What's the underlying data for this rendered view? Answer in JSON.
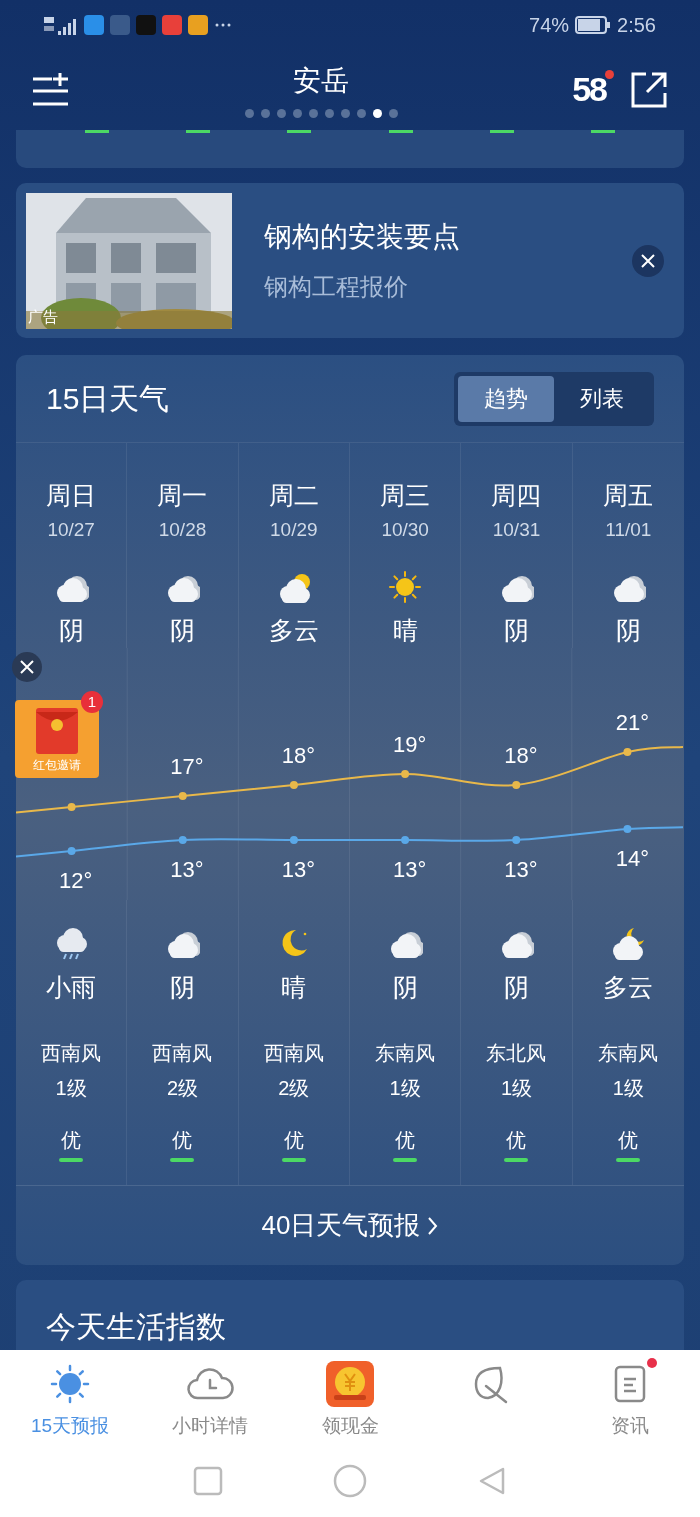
{
  "status_bar": {
    "battery_text": "74%",
    "time": "2:56",
    "app_icons": [
      {
        "color": "#2a8fe8"
      },
      {
        "color": "#3a5a8a"
      },
      {
        "color": "#111111"
      },
      {
        "color": "#e8403a"
      },
      {
        "color": "#e8a020"
      }
    ]
  },
  "header": {
    "city": "安岳",
    "logo_text": "58",
    "page_dots": [
      {
        "selected": false
      },
      {
        "selected": false
      },
      {
        "selected": false
      },
      {
        "selected": false
      },
      {
        "selected": false
      },
      {
        "selected": false
      },
      {
        "selected": false
      },
      {
        "selected": false
      },
      {
        "selected": true
      },
      {
        "selected": false
      }
    ]
  },
  "ad": {
    "tag": "广告",
    "title": "钢构的安装要点",
    "subtitle": "钢构工程报价"
  },
  "forecast": {
    "title": "15日天气",
    "tabs": [
      {
        "label": "趋势",
        "selected": true
      },
      {
        "label": "列表",
        "selected": false
      }
    ],
    "days": [
      {
        "weekday": "周日",
        "date": "10/27",
        "day": {
          "kind": "cloudy",
          "condition": "阴"
        },
        "low": "12°",
        "night": {
          "kind": "light-rain",
          "condition": "小雨"
        },
        "wind_direction": "西南风",
        "wind_level": "1级",
        "aqi": "优"
      },
      {
        "weekday": "周一",
        "date": "10/28",
        "day": {
          "kind": "cloudy",
          "condition": "阴"
        },
        "high": "17°",
        "low": "13°",
        "night": {
          "kind": "cloudy",
          "condition": "阴"
        },
        "wind_direction": "西南风",
        "wind_level": "2级",
        "aqi": "优"
      },
      {
        "weekday": "周二",
        "date": "10/29",
        "day": {
          "kind": "partly-cloudy-day",
          "condition": "多云"
        },
        "high": "18°",
        "low": "13°",
        "night": {
          "kind": "clear-night",
          "condition": "晴"
        },
        "wind_direction": "西南风",
        "wind_level": "2级",
        "aqi": "优"
      },
      {
        "weekday": "周三",
        "date": "10/30",
        "day": {
          "kind": "sunny",
          "condition": "晴"
        },
        "high": "19°",
        "low": "13°",
        "night": {
          "kind": "cloudy",
          "condition": "阴"
        },
        "wind_direction": "东南风",
        "wind_level": "1级",
        "aqi": "优"
      },
      {
        "weekday": "周四",
        "date": "10/31",
        "day": {
          "kind": "cloudy",
          "condition": "阴"
        },
        "high": "18°",
        "low": "13°",
        "night": {
          "kind": "cloudy",
          "condition": "阴"
        },
        "wind_direction": "东北风",
        "wind_level": "1级",
        "aqi": "优"
      },
      {
        "weekday": "周五",
        "date": "11/01",
        "day": {
          "kind": "cloudy",
          "condition": "阴"
        },
        "high": "21°",
        "low": "14°",
        "night": {
          "kind": "partly-cloudy-night",
          "condition": "多云"
        },
        "wind_direction": "东南风",
        "wind_level": "1级",
        "aqi": "优"
      }
    ],
    "more_link": "40日天气预报"
  },
  "life_index": {
    "title": "今天生活指数"
  },
  "red_packet": {
    "label": "红包邀请",
    "badge": "1"
  },
  "bottom_nav": [
    {
      "kind": "sun",
      "label": "15天预报",
      "selected": true,
      "dot": false
    },
    {
      "kind": "clock-cloud",
      "label": "小时详情",
      "selected": false,
      "dot": false
    },
    {
      "kind": "coin",
      "label": "领现金",
      "selected": false,
      "dot": false
    },
    {
      "kind": "leaf",
      "selected": false,
      "dot": false
    },
    {
      "kind": "document",
      "label": "资讯",
      "selected": false,
      "dot": true
    }
  ]
}
